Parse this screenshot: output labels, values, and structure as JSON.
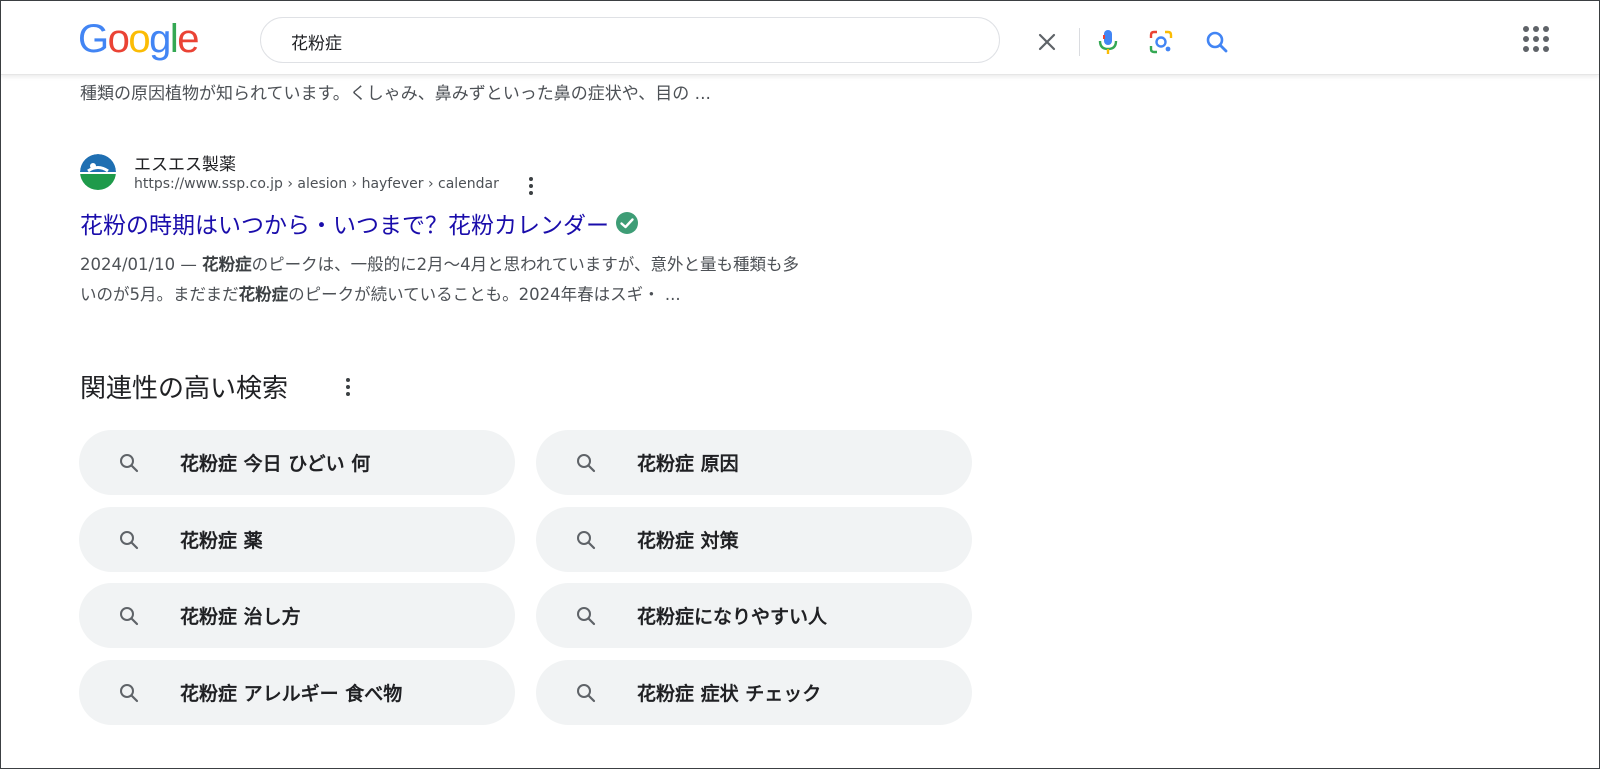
{
  "header": {
    "logo_letters": [
      {
        "char": "G",
        "color": "#4285F4"
      },
      {
        "char": "o",
        "color": "#EA4335"
      },
      {
        "char": "o",
        "color": "#FBBC05"
      },
      {
        "char": "g",
        "color": "#4285F4"
      },
      {
        "char": "l",
        "color": "#34A853"
      },
      {
        "char": "e",
        "color": "#EA4335"
      }
    ],
    "search_query": "花粉症",
    "icons": {
      "clear": "close-icon",
      "voice": "microphone-icon",
      "lens": "camera-lens-icon",
      "search": "search-icon",
      "apps": "apps-grid-icon"
    }
  },
  "top_snippet": "種類の原因植物が知られています。くしゃみ、鼻みずといった鼻の症状や、目の ...",
  "result": {
    "site_name": "エスエス製薬",
    "url": "https://www.ssp.co.jp › alesion › hayfever › calendar",
    "title": "花粉の時期はいつから・いつまで？花粉カレンダー",
    "verified_color": "#3E9D76",
    "snippet_line1_parts": [
      "2024/01/10 — ",
      "花粉症",
      "のピークは、一般的に2月～4月と思われていますが、意外と量も種類も多"
    ],
    "snippet_line2_parts": [
      "いのが5月。まだまだ",
      "花粉症",
      "のピークが続いていることも。2024年春はスギ・ ..."
    ]
  },
  "related": {
    "title": "関連性の高い検索",
    "items": [
      "花粉症 今日 ひどい 何",
      "花粉症 原因",
      "花粉症 薬",
      "花粉症 対策",
      "花粉症 治し方",
      "花粉症になりやすい人",
      "花粉症 アレルギー 食べ物",
      "花粉症 症状 チェック"
    ]
  },
  "colors": {
    "link": "#1a0dab",
    "chip_bg": "#f1f3f4",
    "snippet_text": "#4d5156"
  }
}
